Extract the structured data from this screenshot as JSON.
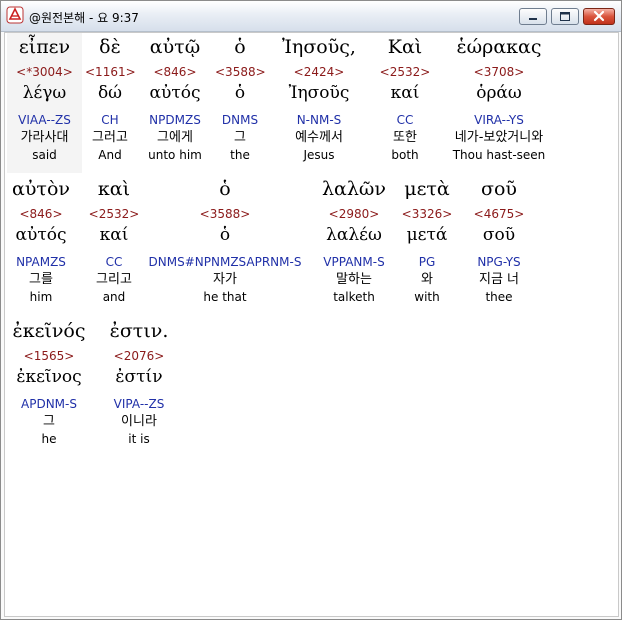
{
  "window": {
    "title": "@원전본해 - 요 9:37"
  },
  "lines": [
    [
      {
        "greek": "εἶπεν",
        "num": "<*3004>",
        "lemma": "λέγω",
        "parse": "VIAA--ZS",
        "korean": "가라사대",
        "english": "said"
      },
      {
        "greek": "δὲ",
        "num": "<1161>",
        "lemma": "δώ",
        "parse": "CH",
        "korean": "그러고",
        "english": "And"
      },
      {
        "greek": "αὐτῷ",
        "num": "<846>",
        "lemma": "αὐτός",
        "parse": "NPDMZS",
        "korean": "그에게",
        "english": "unto him"
      },
      {
        "greek": "ὁ",
        "num": "<3588>",
        "lemma": "ὁ",
        "parse": "DNMS",
        "korean": "그",
        "english": "the"
      },
      {
        "greek": "Ἰησοῦς,",
        "num": "<2424>",
        "lemma": "Ἰησοῦς",
        "parse": "N-NM-S",
        "korean": "예수께서",
        "english": "Jesus"
      },
      {
        "greek": "Καὶ",
        "num": "<2532>",
        "lemma": "καί",
        "parse": "CC",
        "korean": "또한",
        "english": "both"
      },
      {
        "greek": "ἑώρακας",
        "num": "<3708>",
        "lemma": "ὁράω",
        "parse": "VIRA--YS",
        "korean": "네가-보았거니와",
        "english": "Thou hast-seen"
      }
    ],
    [
      {
        "greek": "αὐτὸν",
        "num": "<846>",
        "lemma": "αὐτός",
        "parse": "NPAMZS",
        "korean": "그를",
        "english": "him"
      },
      {
        "greek": "καὶ",
        "num": "<2532>",
        "lemma": "καί",
        "parse": "CC",
        "korean": "그리고",
        "english": "and"
      },
      {
        "greek": "ὁ",
        "num": "<3588>",
        "lemma": "ὁ",
        "parse": "DNMS#NPNMZSAPRNM-S",
        "korean": "자가",
        "english": "he that"
      },
      {
        "greek": "λαλῶν",
        "num": "<2980>",
        "lemma": "λαλέω",
        "parse": "VPPANM-S",
        "korean": "말하는",
        "english": "talketh"
      },
      {
        "greek": "μετὰ",
        "num": "<3326>",
        "lemma": "μετά",
        "parse": "PG",
        "korean": "와",
        "english": "with"
      },
      {
        "greek": "σοῦ",
        "num": "<4675>",
        "lemma": "σοῦ",
        "parse": "NPG-YS",
        "korean": "지금 너",
        "english": "thee"
      }
    ],
    [
      {
        "greek": "ἐκεῖνός",
        "num": "<1565>",
        "lemma": "ἐκεῖνος",
        "parse": "APDNM-S",
        "korean": "그",
        "english": "he"
      },
      {
        "greek": "ἐστιν.",
        "num": "<2076>",
        "lemma": "ἐστίν",
        "parse": "VIPA--ZS",
        "korean": "이니라",
        "english": "it is"
      }
    ]
  ]
}
